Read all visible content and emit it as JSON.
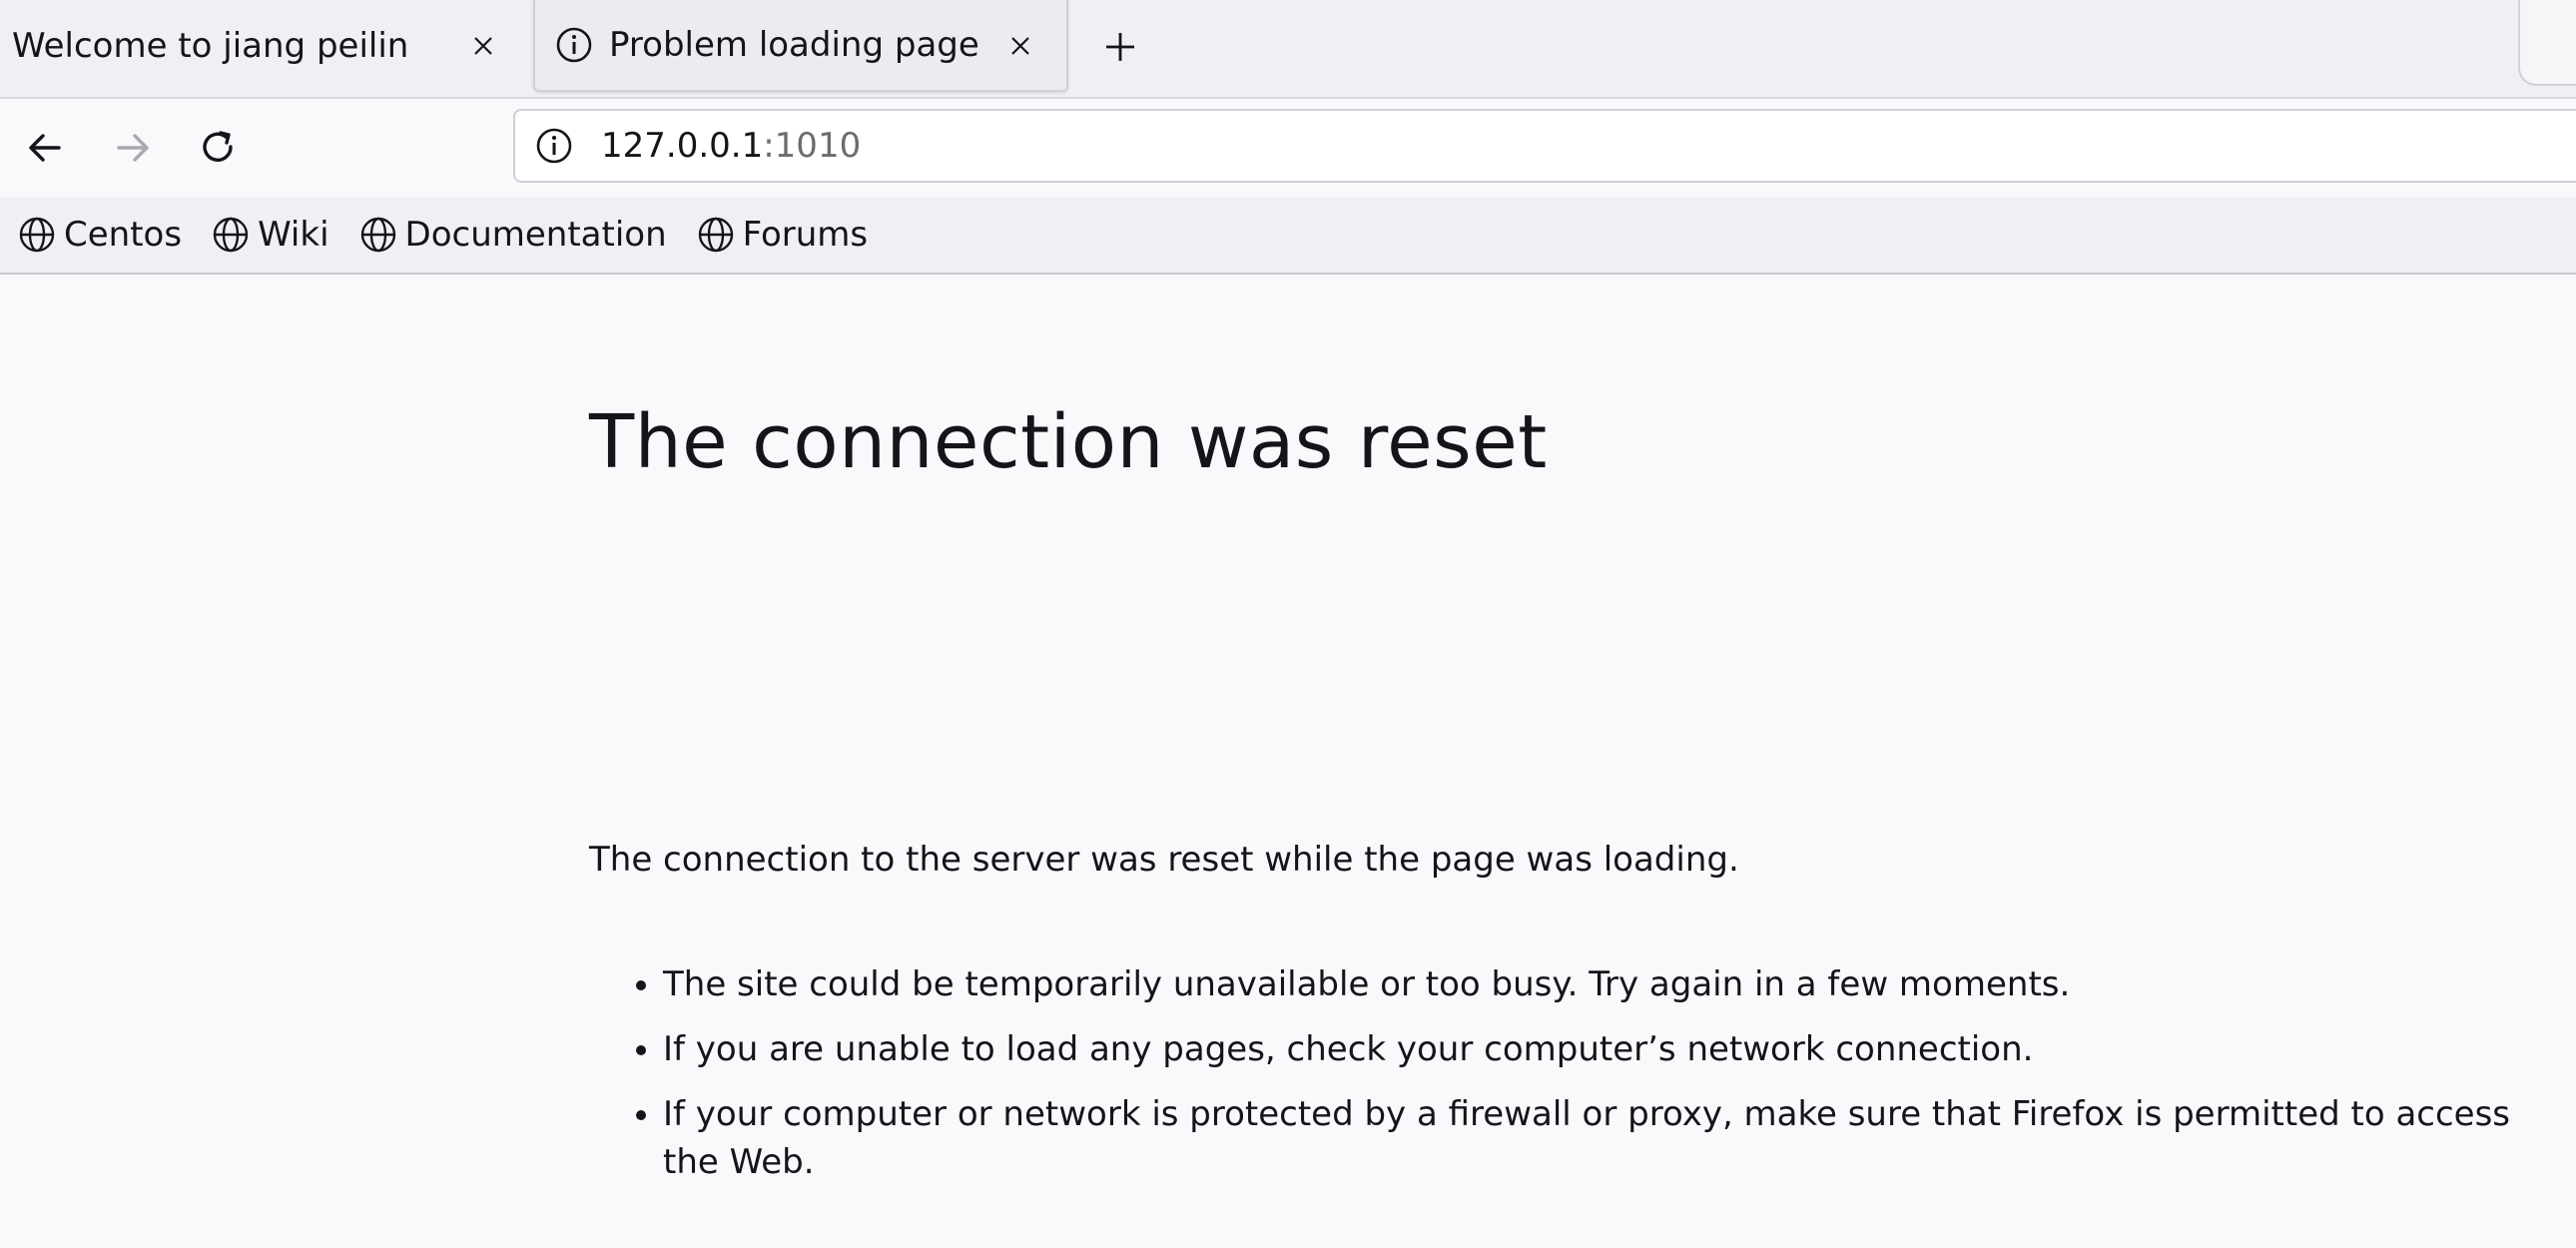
{
  "tabs": [
    {
      "title": "Welcome to jiang peilin",
      "active": false
    },
    {
      "title": "Problem loading page",
      "active": true
    }
  ],
  "url": {
    "host": "127.0.0.1",
    "port": ":1010"
  },
  "bookmarks": [
    "Centos",
    "Wiki",
    "Documentation",
    "Forums"
  ],
  "error": {
    "title": "The connection was reset",
    "description": "The connection to the server was reset while the page was loading.",
    "suggestions": [
      "The site could be temporarily unavailable or too busy. Try again in a few moments.",
      "If you are unable to load any pages, check your computer’s network connection.",
      "If your computer or network is protected by a firewall or proxy, make sure that Firefox is permitted to access the Web."
    ]
  },
  "colors": {
    "text": "#15141a",
    "port": "#6b6b72",
    "background": "#f9f9fb",
    "toolbar": "#f0f0f4"
  },
  "icons": [
    "close-icon",
    "info-icon",
    "plus-icon",
    "back-arrow-icon",
    "forward-arrow-icon",
    "reload-icon",
    "globe-icon"
  ]
}
